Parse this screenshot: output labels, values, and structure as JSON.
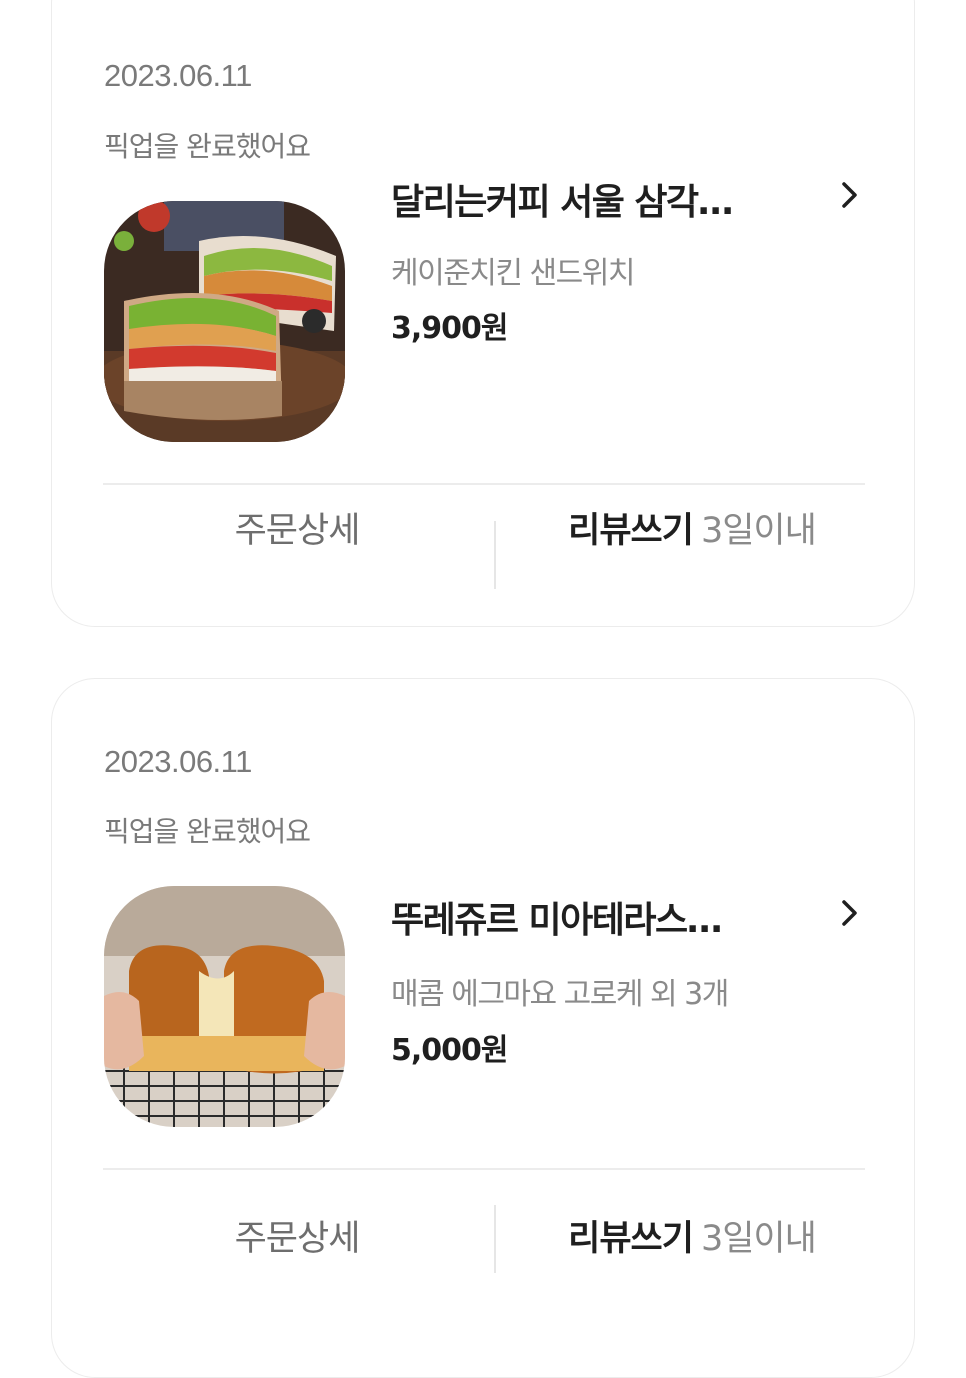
{
  "orders": [
    {
      "date": "2023.06.11",
      "status": "픽업을 완료했어요",
      "store": "달리는커피 서울 삼각…",
      "menu": "케이준치킨 샌드위치",
      "price": "3,900원",
      "detail_label": "주문상세",
      "review_label": "리뷰쓰기",
      "review_due": "3일이내",
      "thumb_icon": "sandwich-photo"
    },
    {
      "date": "2023.06.11",
      "status": "픽업을 완료했어요",
      "store": "뚜레쥬르 미아테라스…",
      "menu": "매콤 에그마요 고로케 외 3개",
      "price": "5,000원",
      "detail_label": "주문상세",
      "review_label": "리뷰쓰기",
      "review_due": "3일이내",
      "thumb_icon": "bread-photo"
    }
  ],
  "colors": {
    "text_primary": "#1f1f1f",
    "text_secondary": "#7a7a7a",
    "border": "#ececec"
  }
}
